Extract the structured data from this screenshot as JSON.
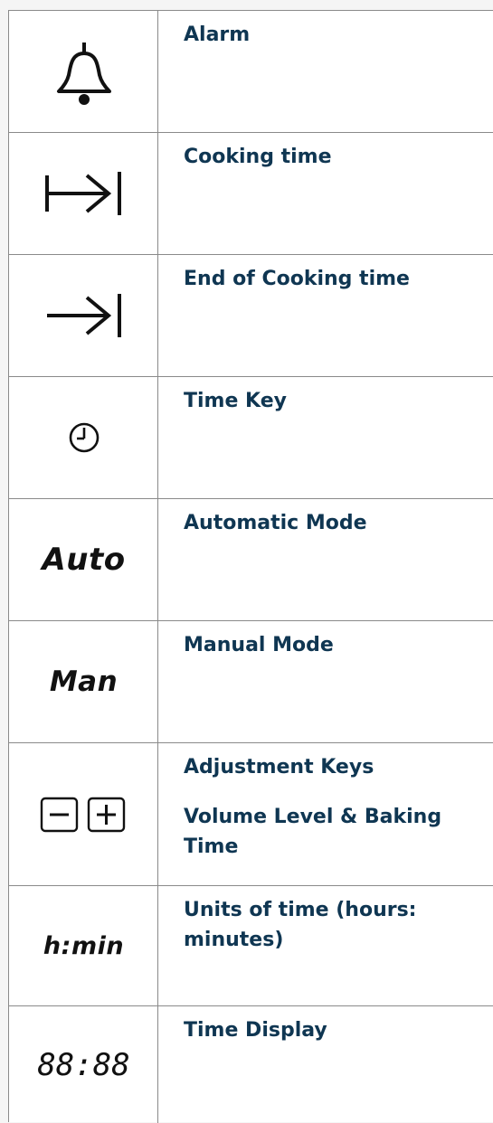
{
  "rows": [
    {
      "icon": "bell-icon",
      "label": "Alarm"
    },
    {
      "icon": "cooking-time-icon",
      "label": "Cooking time"
    },
    {
      "icon": "end-cooking-time-icon",
      "label": "End of Cooking time"
    },
    {
      "icon": "clock-icon",
      "label": "Time Key"
    },
    {
      "icon": "auto-text-icon",
      "icon_text": "Auto",
      "label": "Automatic Mode"
    },
    {
      "icon": "man-text-icon",
      "icon_text": "Man",
      "label": "Manual Mode"
    },
    {
      "icon": "minus-plus-icon",
      "label": "Adjustment Keys",
      "label2": "Volume Level & Baking Time"
    },
    {
      "icon": "hmin-text-icon",
      "icon_text": "h:min",
      "label": "Units of time (hours: minutes)"
    },
    {
      "icon": "digital-display-icon",
      "icon_text": "88:88",
      "label": "Time Display"
    }
  ]
}
